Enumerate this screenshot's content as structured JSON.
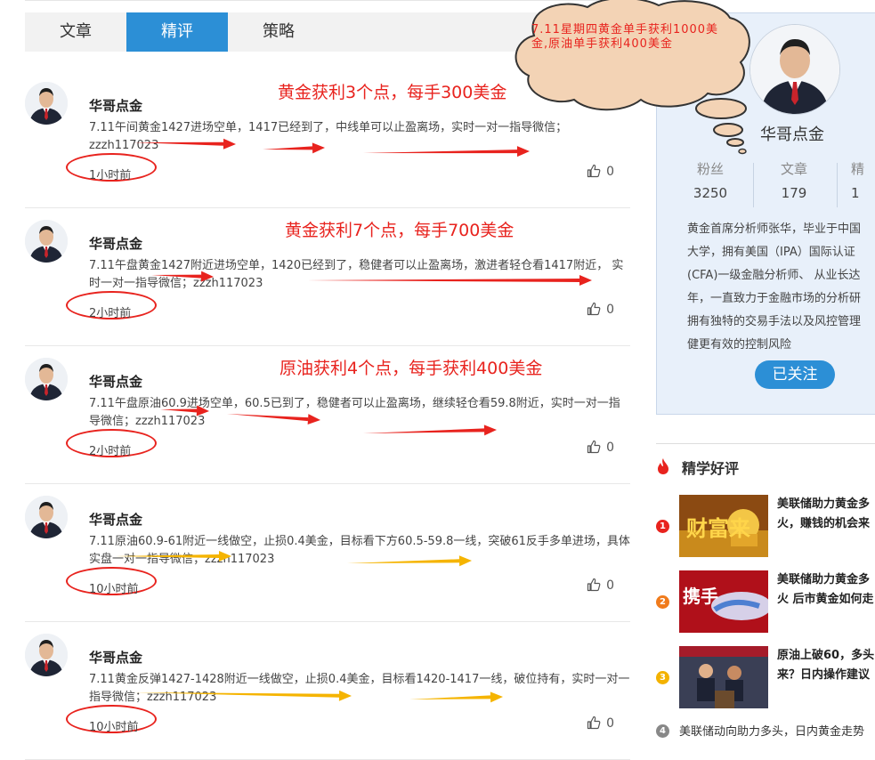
{
  "tabs": [
    {
      "label": "文章"
    },
    {
      "label": "精评"
    },
    {
      "label": "策略"
    }
  ],
  "bubble": {
    "text": "7.11星期四黄金单手获利1000美金,原油单手获利400美金"
  },
  "posts": [
    {
      "author": "华哥点金",
      "content": "7.11午间黄金1427进场空单，1417已经到了，中线单可以止盈离场，实时一对一指导微信；zzzh117023",
      "time": "1小时前",
      "likes": "0",
      "annotation": "黄金获利3个点，每手300美金"
    },
    {
      "author": "华哥点金",
      "content": "7.11午盘黄金1427附近进场空单，1420已经到了，稳健者可以止盈离场，激进者轻仓看1417附近， 实时一对一指导微信；zzzh117023",
      "time": "2小时前",
      "likes": "0",
      "annotation": "黄金获利7个点，每手700美金"
    },
    {
      "author": "华哥点金",
      "content": "7.11午盘原油60.9进场空单，60.5已到了，稳健者可以止盈离场，继续轻仓看59.8附近，实时一对一指导微信；zzzh117023",
      "time": "2小时前",
      "likes": "0",
      "annotation": "原油获利4个点，每手获利400美金"
    },
    {
      "author": "华哥点金",
      "content": "7.11原油60.9-61附近一线做空，止损0.4美金，目标看下方60.5-59.8一线，突破61反手多单进场，具体实盘一对一指导微信；zzzh117023",
      "time": "10小时前",
      "likes": "0",
      "annotation": ""
    },
    {
      "author": "华哥点金",
      "content": "7.11黄金反弹1427-1428附近一线做空，止损0.4美金，目标看1420-1417一线，破位持有，实时一对一指导微信；zzzh117023",
      "time": "10小时前",
      "likes": "0",
      "annotation": ""
    }
  ],
  "profile": {
    "name": "华哥点金",
    "stats": [
      {
        "label": "粉丝",
        "value": "3250"
      },
      {
        "label": "文章",
        "value": "179"
      },
      {
        "label": "精",
        "value": "1"
      }
    ],
    "bio": [
      "黄金首席分析师张华，毕业于中国",
      "大学，拥有美国（IPA）国际认证",
      "(CFA)一级金融分析师、 从业长达",
      "年，一直致力于金融市场的分析研",
      "拥有独特的交易手法以及风控管理",
      "健更有效的控制风险"
    ],
    "follow_label": "已关注"
  },
  "section": {
    "title": "精学好评"
  },
  "news": [
    {
      "num": "1",
      "title1": "美联储助力黄金多",
      "title2": "火，赚钱的机会来",
      "thumb_text": "财富来"
    },
    {
      "num": "2",
      "title1": "美联储助力黄金多",
      "title2": "火 后市黄金如何走",
      "thumb_text": "携手"
    },
    {
      "num": "3",
      "title1": "原油上破60，多头",
      "title2": "来？日内操作建议",
      "thumb_text": ""
    },
    {
      "num": "4",
      "title1": "美联储动向助力多头，日内黄金走势",
      "title2": "",
      "thumb_text": ""
    }
  ],
  "colors": {
    "accent": "#2c8fd6",
    "annotation_red": "#e8231e",
    "arrow_yellow": "#f5b400"
  }
}
